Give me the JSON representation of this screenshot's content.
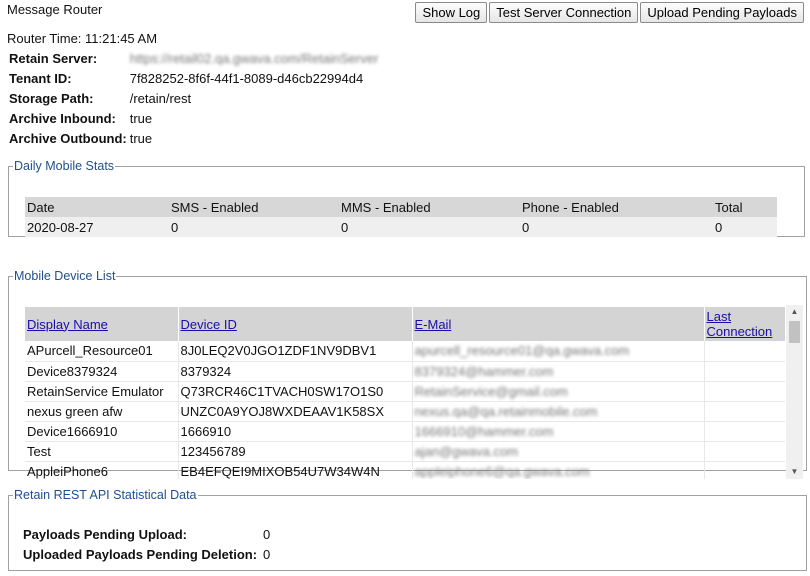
{
  "app": {
    "title": "Message Router"
  },
  "toolbar": {
    "show_log": "Show Log",
    "test_server": "Test Server Connection",
    "upload_pending": "Upload Pending Payloads"
  },
  "router_time": "Router Time: 11:21:45 AM",
  "info": {
    "retain_server_label": "Retain Server:",
    "retain_server_value": "https://retail02.qa.gwava.com/RetainServer",
    "tenant_label": "Tenant ID:",
    "tenant_value": "7f828252-8f6f-44f1-8089-d46cb22994d4",
    "storage_label": "Storage Path:",
    "storage_value": "/retain/rest",
    "archive_in_label": "Archive Inbound:",
    "archive_in_value": "true",
    "archive_out_label": "Archive Outbound:",
    "archive_out_value": "true"
  },
  "stats": {
    "legend": "Daily Mobile Stats",
    "headers": [
      "Date",
      "SMS - Enabled",
      "MMS - Enabled",
      "Phone - Enabled",
      "Total"
    ],
    "rows": [
      [
        "2020-08-27",
        "0",
        "0",
        "0",
        "0"
      ]
    ]
  },
  "devices": {
    "legend": "Mobile Device List",
    "headers": [
      "Display Name",
      "Device ID",
      "E-Mail",
      "Last Connection"
    ],
    "rows": [
      [
        "APurcell_Resource01",
        "8J0LEQ2V0JGO1ZDF1NV9DBV1",
        "apurcell_resource01@qa.gwava.com",
        ""
      ],
      [
        "Device8379324",
        "8379324",
        "8379324@hammer.com",
        ""
      ],
      [
        "RetainService Emulator",
        "Q73RCR46C1TVACH0SW17O1S0",
        "RetainService@gmail.com",
        ""
      ],
      [
        "nexus green afw",
        "UNZC0A9YOJ8WXDEAAV1K58SX",
        "nexus.qa@qa.retainmobile.com",
        ""
      ],
      [
        "Device1666910",
        "1666910",
        "1666910@hammer.com",
        ""
      ],
      [
        "Test",
        "123456789",
        "ajan@gwava.com",
        ""
      ],
      [
        "AppleiPhone6",
        "EB4EFQEI9MIXOB54U7W34W4N",
        "appleiphone6@qa.gwava.com",
        ""
      ]
    ]
  },
  "rest": {
    "legend": "Retain REST API Statistical Data",
    "pending_upload_label": "Payloads Pending Upload:",
    "pending_upload_value": "0",
    "pending_delete_label": "Uploaded Payloads Pending Deletion:",
    "pending_delete_value": "0"
  }
}
